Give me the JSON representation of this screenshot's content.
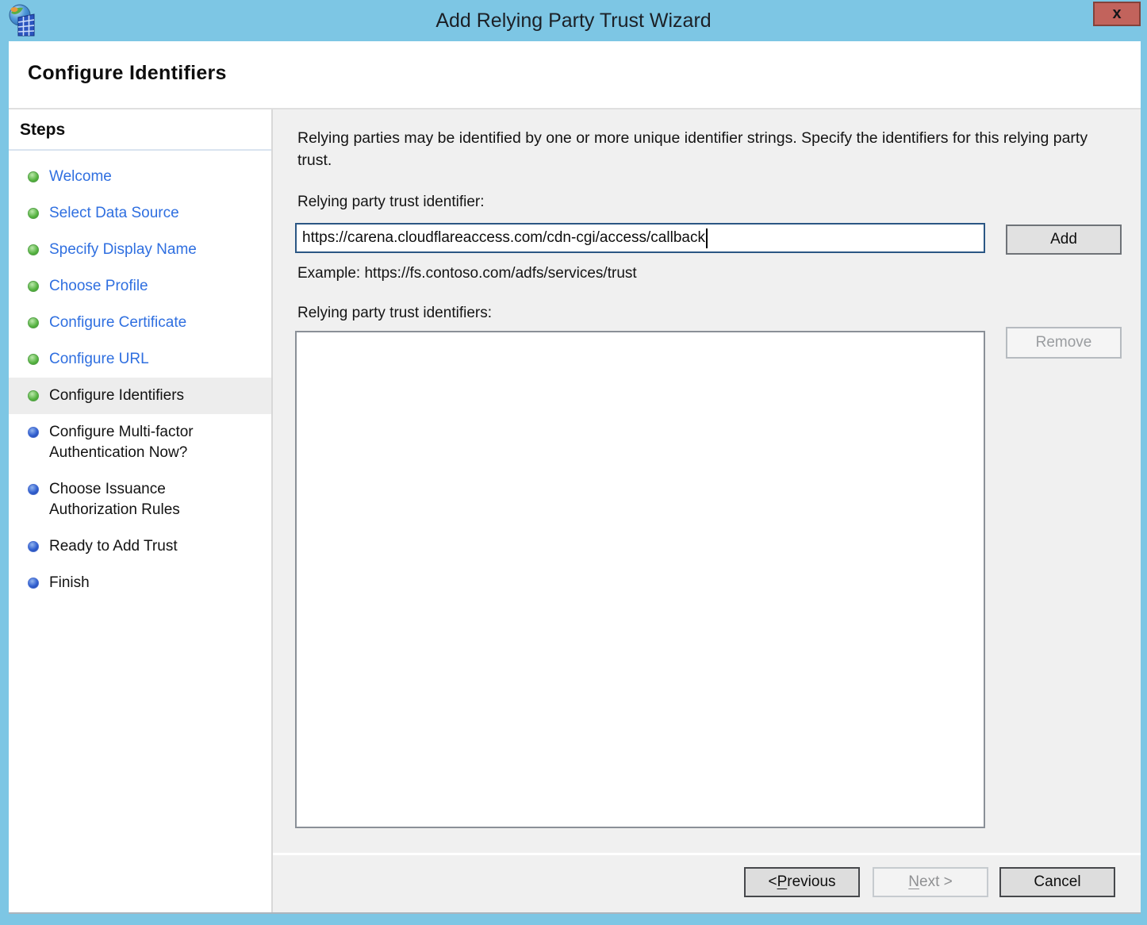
{
  "window": {
    "title": "Add Relying Party Trust Wizard",
    "close_label": "x",
    "app_icon": "adfs-globe-building-icon"
  },
  "header": {
    "title": "Configure Identifiers"
  },
  "sidebar": {
    "heading": "Steps",
    "items": [
      {
        "label": "Welcome",
        "state": "done"
      },
      {
        "label": "Select Data Source",
        "state": "done"
      },
      {
        "label": "Specify Display Name",
        "state": "done"
      },
      {
        "label": "Choose Profile",
        "state": "done"
      },
      {
        "label": "Configure Certificate",
        "state": "done"
      },
      {
        "label": "Configure URL",
        "state": "done"
      },
      {
        "label": "Configure Identifiers",
        "state": "current"
      },
      {
        "label": "Configure Multi-factor Authentication Now?",
        "state": "pending"
      },
      {
        "label": "Choose Issuance Authorization Rules",
        "state": "pending"
      },
      {
        "label": "Ready to Add Trust",
        "state": "pending"
      },
      {
        "label": "Finish",
        "state": "pending"
      }
    ]
  },
  "main": {
    "description": "Relying parties may be identified by one or more unique identifier strings. Specify the identifiers for this relying party trust.",
    "identifier_label": "Relying party trust identifier:",
    "identifier_value": "https://carena.cloudflareaccess.com/cdn-cgi/access/callback",
    "add_button": "Add",
    "example": "Example: https://fs.contoso.com/adfs/services/trust",
    "identifiers_list_label": "Relying party trust identifiers:",
    "identifiers": [],
    "remove_button": "Remove",
    "remove_disabled": true
  },
  "footer": {
    "previous": {
      "label": "< Previous",
      "underline": "P",
      "disabled": false
    },
    "next": {
      "label": "Next >",
      "underline": "N",
      "disabled": true
    },
    "cancel": {
      "label": "Cancel",
      "underline": "",
      "disabled": false
    }
  },
  "colors": {
    "titlebar_blue": "#7DC6E4",
    "close_red": "#C2635C",
    "link_blue": "#2F6FE0",
    "done_bullet_green": "#54B23F",
    "pending_bullet_blue": "#2F5ECF",
    "current_step_highlight": "#EDEDED",
    "main_background": "#F0F0F0",
    "input_focus_border": "#2B5784"
  }
}
